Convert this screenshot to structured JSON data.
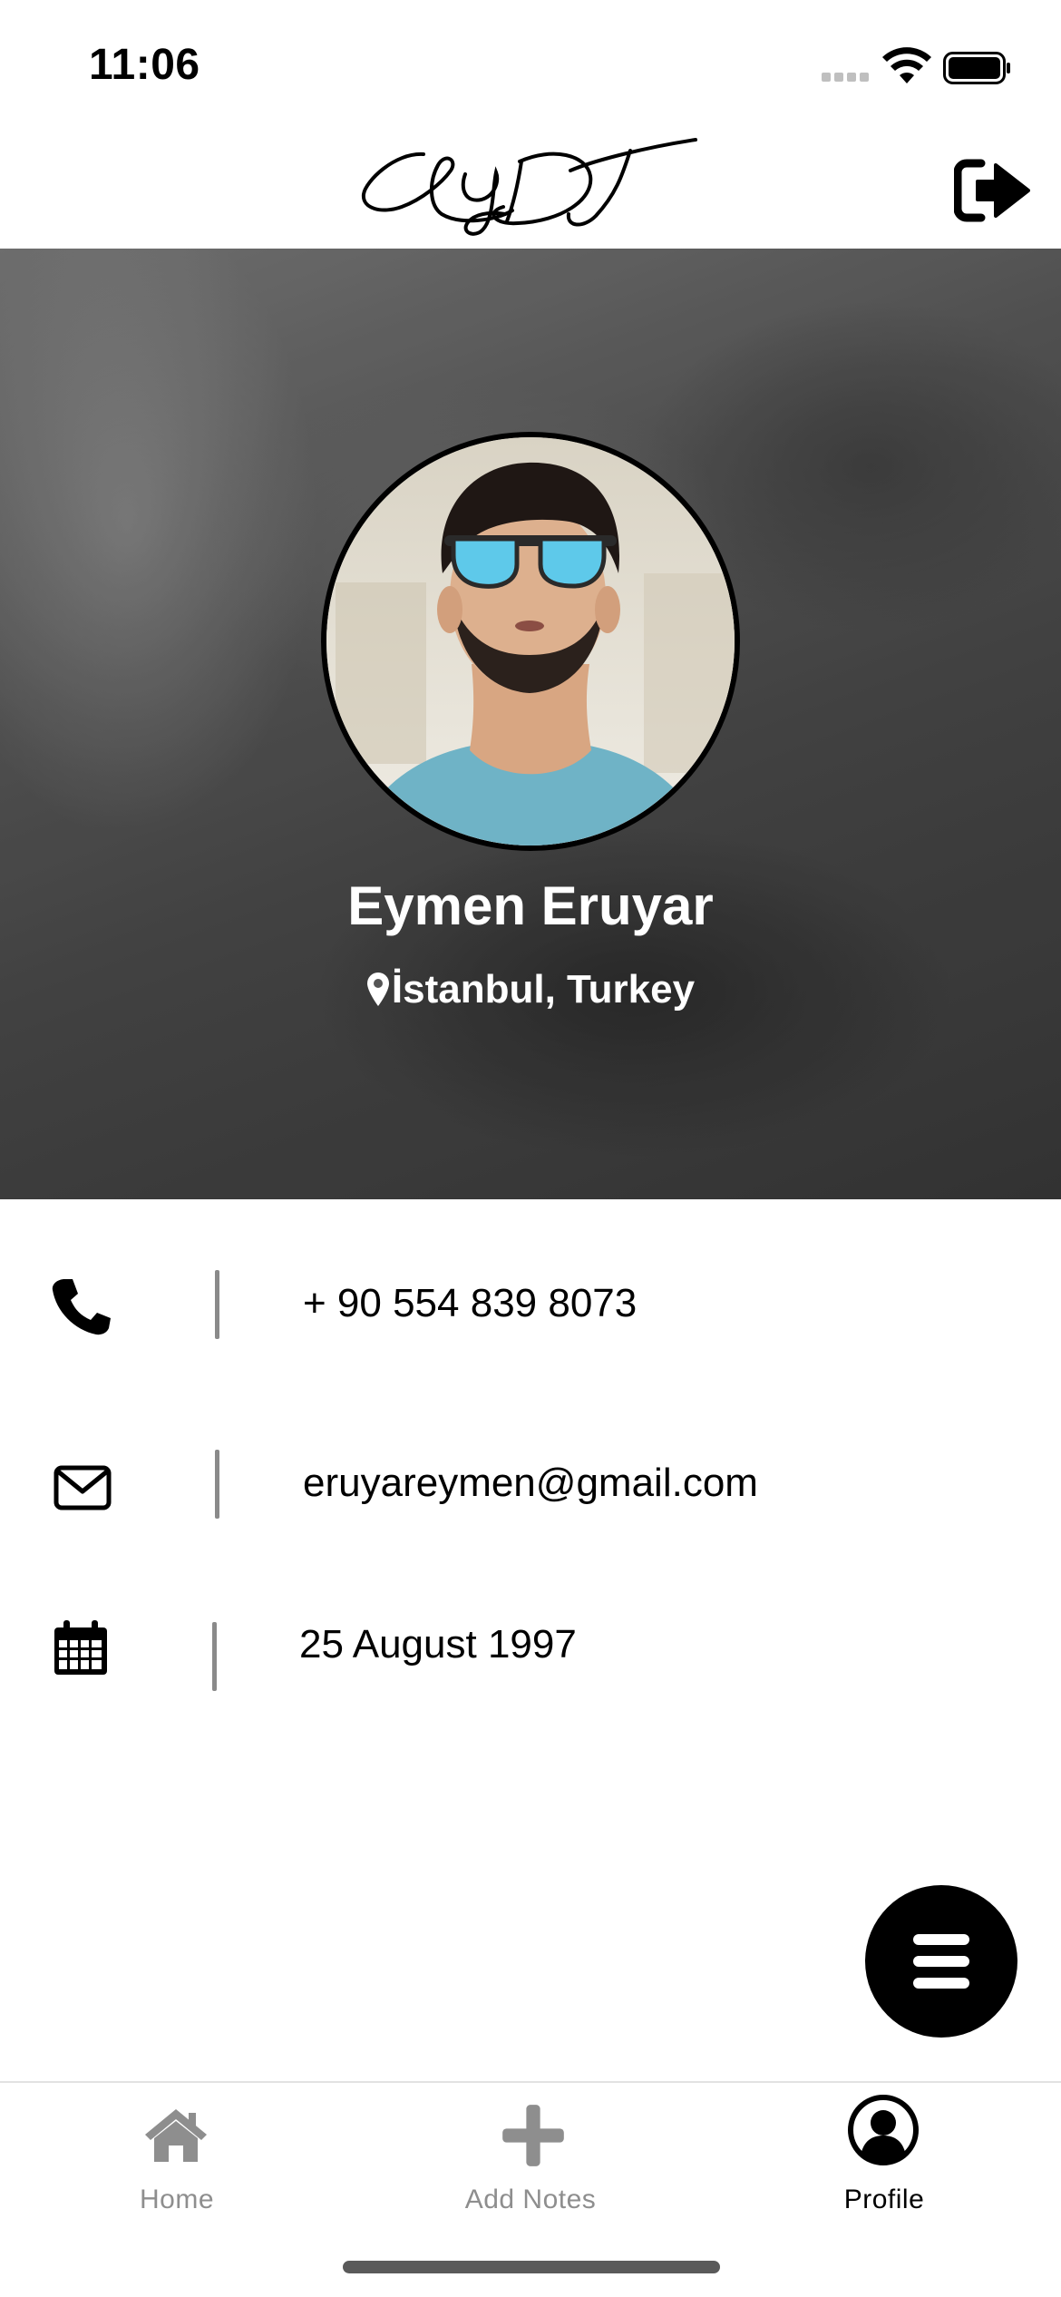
{
  "status_bar": {
    "time": "11:06",
    "icons": [
      "cellular-signal-icon",
      "wifi-icon",
      "battery-icon"
    ]
  },
  "header": {
    "logo_text": "LYT",
    "logout_icon": "sign-out-icon"
  },
  "profile": {
    "name": "Eymen Eruyar",
    "location": "İstanbul, Turkey",
    "location_icon": "map-pin-icon"
  },
  "info": [
    {
      "icon": "phone-icon",
      "value": "+ 90 554 839 8073"
    },
    {
      "icon": "envelope-icon",
      "value": "eruyareymen@gmail.com"
    },
    {
      "icon": "calendar-icon",
      "value": "25 August 1997"
    }
  ],
  "fab": {
    "icon": "hamburger-menu-icon"
  },
  "tab_bar": {
    "tabs": [
      {
        "label": "Home",
        "icon": "home-icon",
        "active": false
      },
      {
        "label": "Add Notes",
        "icon": "plus-icon",
        "active": false
      },
      {
        "label": "Profile",
        "icon": "user-circle-icon",
        "active": true
      }
    ]
  },
  "colors": {
    "accent": "#000000",
    "inactive_tab": "#8e8e8e",
    "divider": "#8a8a8a",
    "background": "#ffffff"
  }
}
